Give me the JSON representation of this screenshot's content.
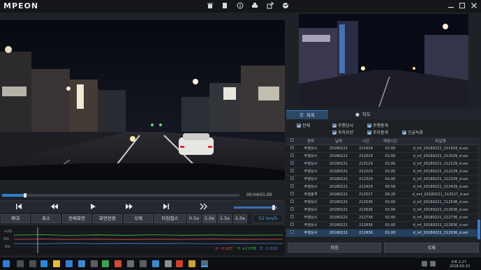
{
  "app": {
    "title": "MPEON",
    "toolbar_icons": [
      "trash-icon",
      "document-icon",
      "info-icon",
      "print-icon",
      "export-icon",
      "globe-icon"
    ],
    "window_controls": [
      "minimize-icon",
      "maximize-icon",
      "close-icon"
    ]
  },
  "player": {
    "time_label": "00:04/01:00",
    "progress_fraction": 0.09,
    "volume_fraction": 0.95,
    "controls": [
      "skip-start-icon",
      "rewind-icon",
      "play-icon",
      "fast-forward-icon",
      "skip-end-icon",
      "next-icon"
    ],
    "buttons": {
      "zoom_in": "확대",
      "zoom_out": "축소",
      "fullscreen": "전체화면",
      "screen_switch": "화면전환",
      "delete": "삭제",
      "timelapse": "타임랩스"
    },
    "speeds": [
      "0.5x",
      "1.0x",
      "1.5x",
      "2.0x"
    ],
    "speed_readout": "52 km/h"
  },
  "gsensor": {
    "labels": [
      "+2G",
      "0G",
      "-2G"
    ],
    "x_readout": "X: -0.003",
    "y_readout": "Y: +1.078",
    "z_readout": "Z: -1.019",
    "x_color": "#e04848",
    "y_color": "#48c848",
    "z_color": "#4888e0"
  },
  "panel": {
    "tab_list": "목록",
    "tab_map": "지도",
    "filters": {
      "all": "전체",
      "driving_normal": "주행상시",
      "driving_impact": "주행충격",
      "parking_motion": "주차모션",
      "parking_impact": "주차충격",
      "emergency": "긴급녹화"
    },
    "columns": [
      "종류",
      "날짜",
      "시간",
      "재생시간",
      "파일명"
    ],
    "rows": [
      {
        "type": "주행상시",
        "date": "20180221",
        "time": "211929",
        "duration": "01:00",
        "file": "d_inf_20180221_211929_d.avi"
      },
      {
        "type": "주행상시",
        "date": "20180221",
        "time": "212029",
        "duration": "01:00",
        "file": "d_inf_20180221_212029_d.avi"
      },
      {
        "type": "주행상시",
        "date": "20180221",
        "time": "212129",
        "duration": "01:00",
        "file": "d_inf_20180221_212129_d.avi"
      },
      {
        "type": "주행상시",
        "date": "20180221",
        "time": "212229",
        "duration": "01:00",
        "file": "d_inf_20180221_212229_d.avi"
      },
      {
        "type": "주행상시",
        "date": "20180221",
        "time": "212329",
        "duration": "01:00",
        "file": "d_inf_20180221_212329_d.avi"
      },
      {
        "type": "주행상시",
        "date": "20180221",
        "time": "212429",
        "duration": "00:58",
        "file": "d_inf_20180221_212429_d.avi"
      },
      {
        "type": "주행충격",
        "date": "20180221",
        "time": "212527",
        "duration": "00:20",
        "file": "d_evt_20180221_212527_d.avi"
      },
      {
        "type": "주행상시",
        "date": "20180221",
        "time": "212536",
        "duration": "01:00",
        "file": "d_inf_20180221_212536_d.avi"
      },
      {
        "type": "주행상시",
        "date": "20180221",
        "time": "212636",
        "duration": "01:00",
        "file": "d_inf_20180221_212636_d.avi"
      },
      {
        "type": "주행상시",
        "date": "20180221",
        "time": "212736",
        "duration": "01:00",
        "file": "d_inf_20180221_212736_d.avi"
      },
      {
        "type": "주행상시",
        "date": "20180221",
        "time": "212836",
        "duration": "01:00",
        "file": "d_inf_20180221_212836_d.avi"
      },
      {
        "type": "주행상시",
        "date": "20180221",
        "time": "212936",
        "duration": "01:00",
        "file": "d_inf_20180221_212936_d.avi"
      }
    ],
    "save_label": "저장",
    "delete_label": "삭제"
  },
  "taskbar": {
    "clock_time": "오후 2:17",
    "clock_date": "2018-02-23"
  }
}
